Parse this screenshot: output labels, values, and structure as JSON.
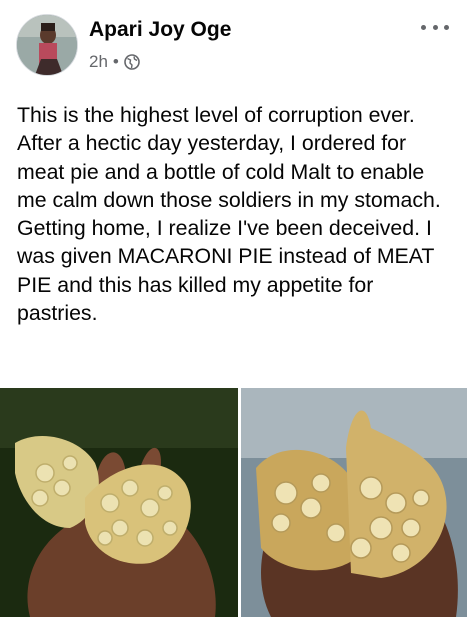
{
  "post": {
    "author": "Apari Joy Oge",
    "time": "2h",
    "separator": "•",
    "audience_icon": "globe-icon",
    "more_icon": "more-options-icon",
    "text": "This is the highest level of corruption ever.\nAfter a hectic day yesterday, I ordered for meat pie and a bottle of cold Malt to enable me calm down those soldiers in my stomach. Getting home, I realize I've been deceived. I was given MACARONI PIE instead of MEAT PIE and this has killed my appetite for pastries."
  },
  "photos": [
    {
      "subject": "hand-holding-macaroni-pie-photo"
    },
    {
      "subject": "hand-holding-broken-macaroni-pie-photo"
    }
  ],
  "colors": {
    "text": "#050505",
    "secondary": "#65676b",
    "pastry": "#d9c27a",
    "macaroni": "#e8dca6",
    "skin": "#6b3f2a"
  }
}
